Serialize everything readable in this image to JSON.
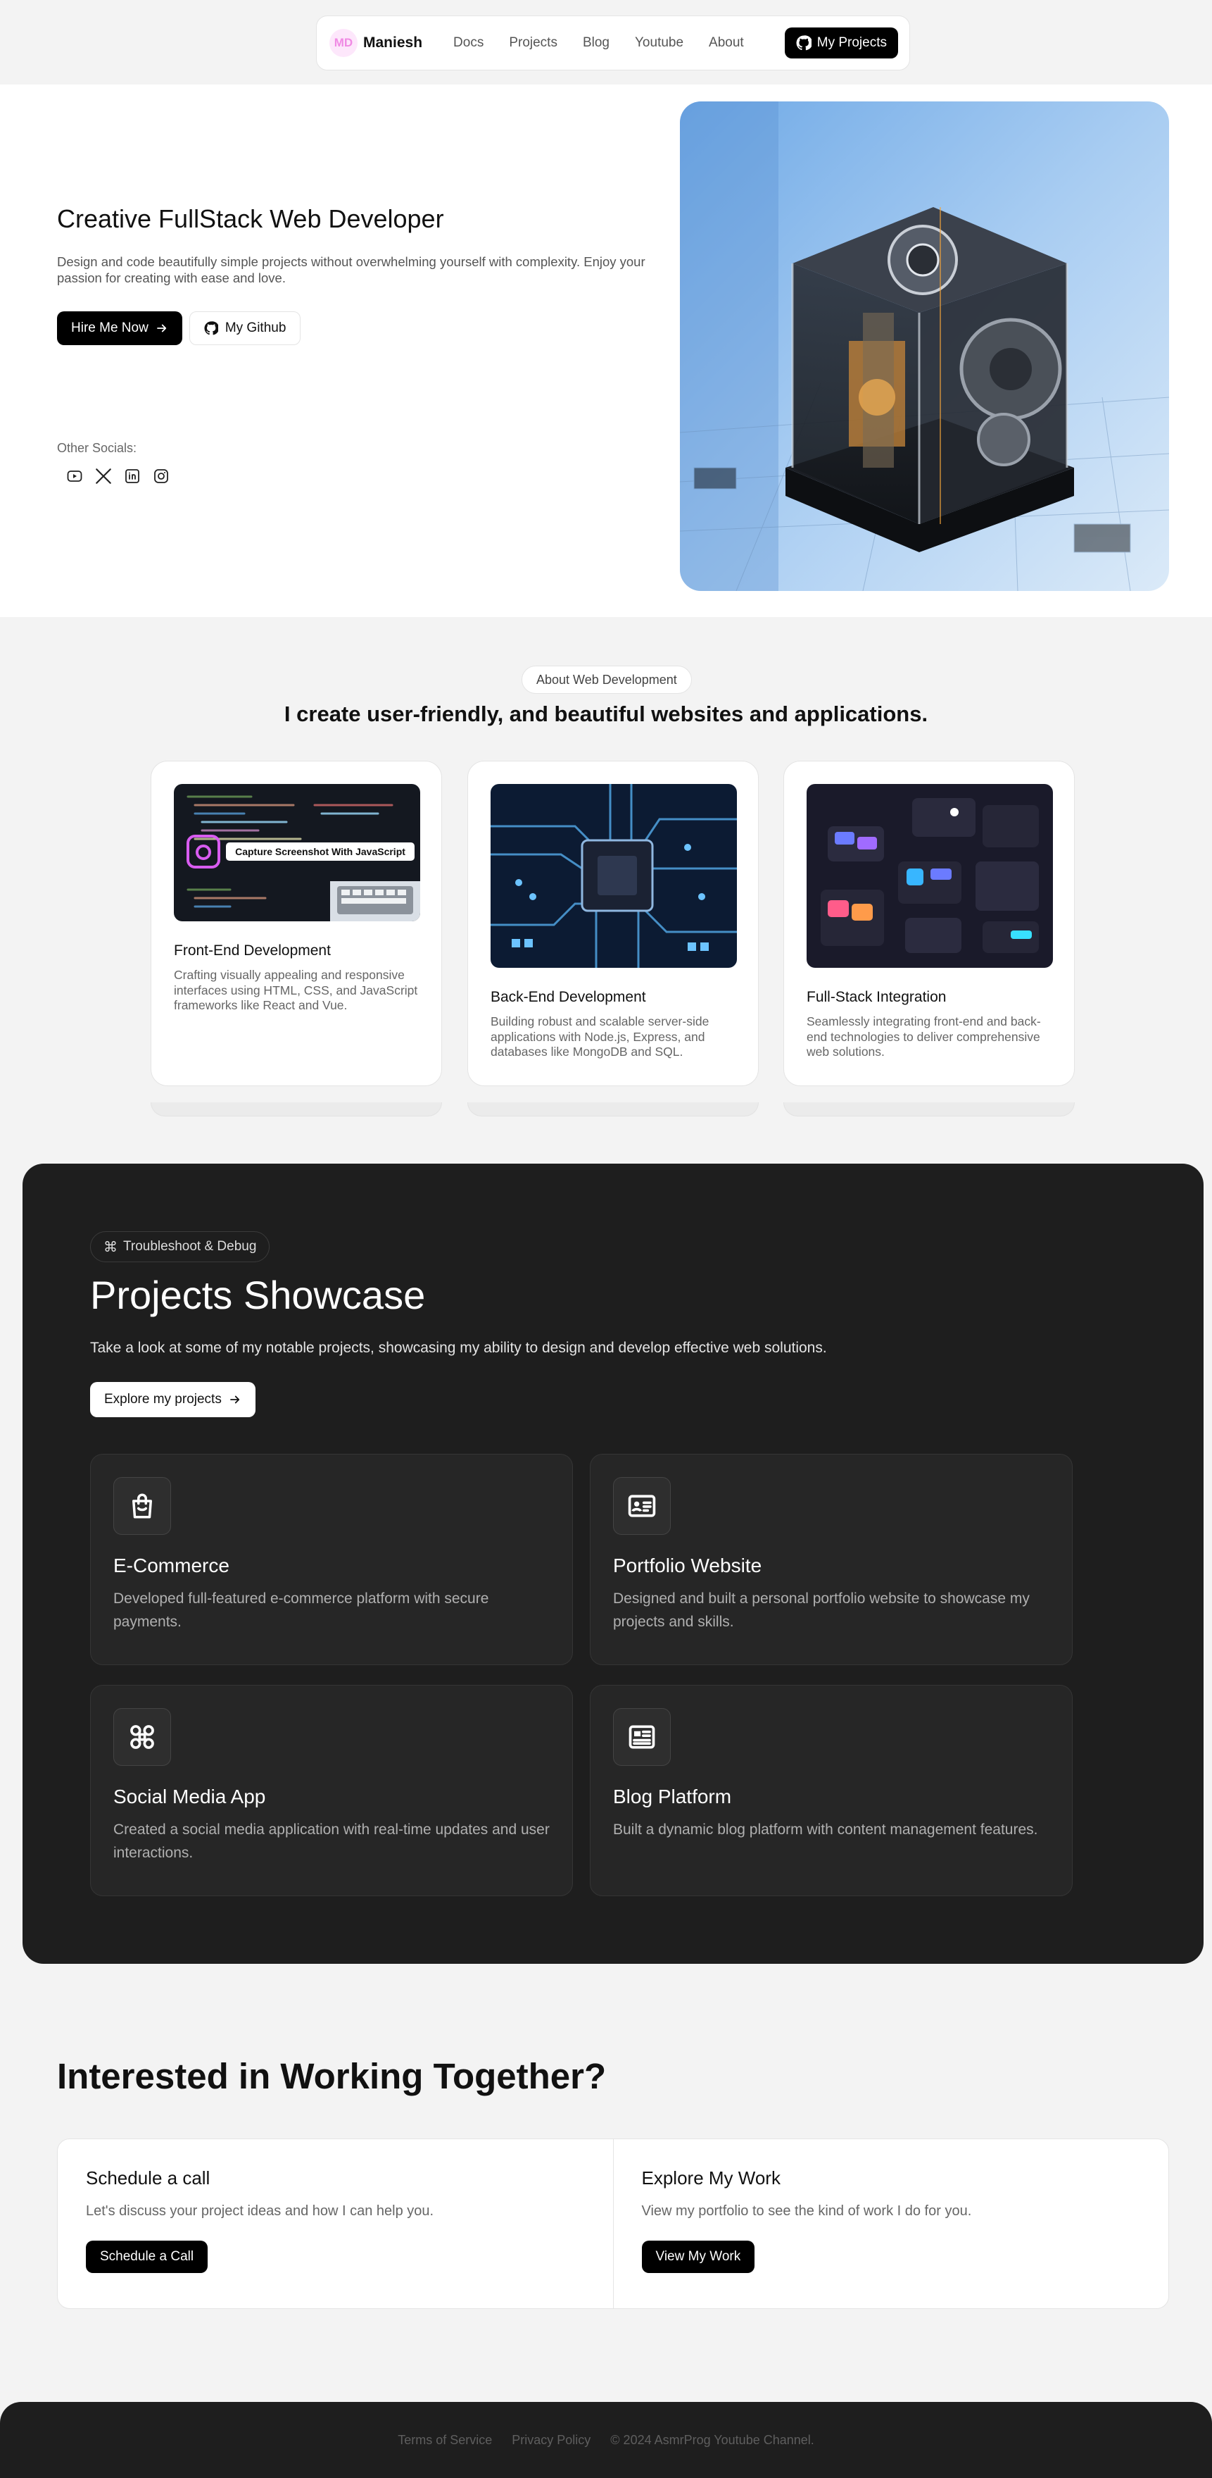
{
  "nav": {
    "logo_text": "MD",
    "brand": "Maniesh",
    "links": [
      "Docs",
      "Projects",
      "Blog",
      "Youtube",
      "About"
    ],
    "cta": "My Projects"
  },
  "hero": {
    "title": "Creative FullStack Web Developer",
    "description": "Design and code beautifully simple projects without overwhelming yourself with complexity. Enjoy your passion for creating with ease and love.",
    "primary_button": "Hire Me Now",
    "secondary_button": "My Github",
    "socials_label": "Other Socials:",
    "socials": [
      "youtube-icon",
      "x-icon",
      "linkedin-icon",
      "instagram-icon"
    ]
  },
  "about": {
    "chip": "About Web Development",
    "heading": "I create user-friendly, and beautiful websites and applications.",
    "cards": [
      {
        "title": "Front-End Development",
        "description": "Crafting visually appealing and responsive interfaces using HTML, CSS, and JavaScript frameworks like React and Vue.",
        "image_caption": "Capture Screenshot With JavaScript"
      },
      {
        "title": "Back-End Development",
        "description": "Building robust and scalable server-side applications with Node.js, Express, and databases like MongoDB and SQL."
      },
      {
        "title": "Full-Stack Integration",
        "description": "Seamlessly integrating front-end and back-end technologies to deliver comprehensive web solutions."
      }
    ]
  },
  "projects": {
    "chip": "Troubleshoot & Debug",
    "title": "Projects Showcase",
    "description": "Take a look at some of my notable projects, showcasing my ability to design and develop effective web solutions.",
    "button": "Explore my projects",
    "items": [
      {
        "title": "E-Commerce",
        "description": "Developed full-featured e-commerce platform with secure payments.",
        "icon": "shopping-bag-icon"
      },
      {
        "title": "Portfolio Website",
        "description": "Designed and built a personal portfolio website to showcase my projects and skills.",
        "icon": "id-card-icon"
      },
      {
        "title": "Social Media App",
        "description": "Created a social media application with real-time updates and user interactions.",
        "icon": "command-icon"
      },
      {
        "title": "Blog Platform",
        "description": "Built a dynamic blog platform with content management features.",
        "icon": "newspaper-icon"
      }
    ]
  },
  "contact": {
    "title": "Interested in Working Together?",
    "columns": [
      {
        "title": "Schedule a call",
        "description": "Let's discuss your project ideas and how I can help you.",
        "button": "Schedule a Call"
      },
      {
        "title": "Explore My Work",
        "description": "View my portfolio to see the kind of work I do for you.",
        "button": "View My Work"
      }
    ]
  },
  "footer": {
    "links": [
      "Terms of Service",
      "Privacy Policy"
    ],
    "copyright": "© 2024 AsmrProg Youtube Channel."
  }
}
